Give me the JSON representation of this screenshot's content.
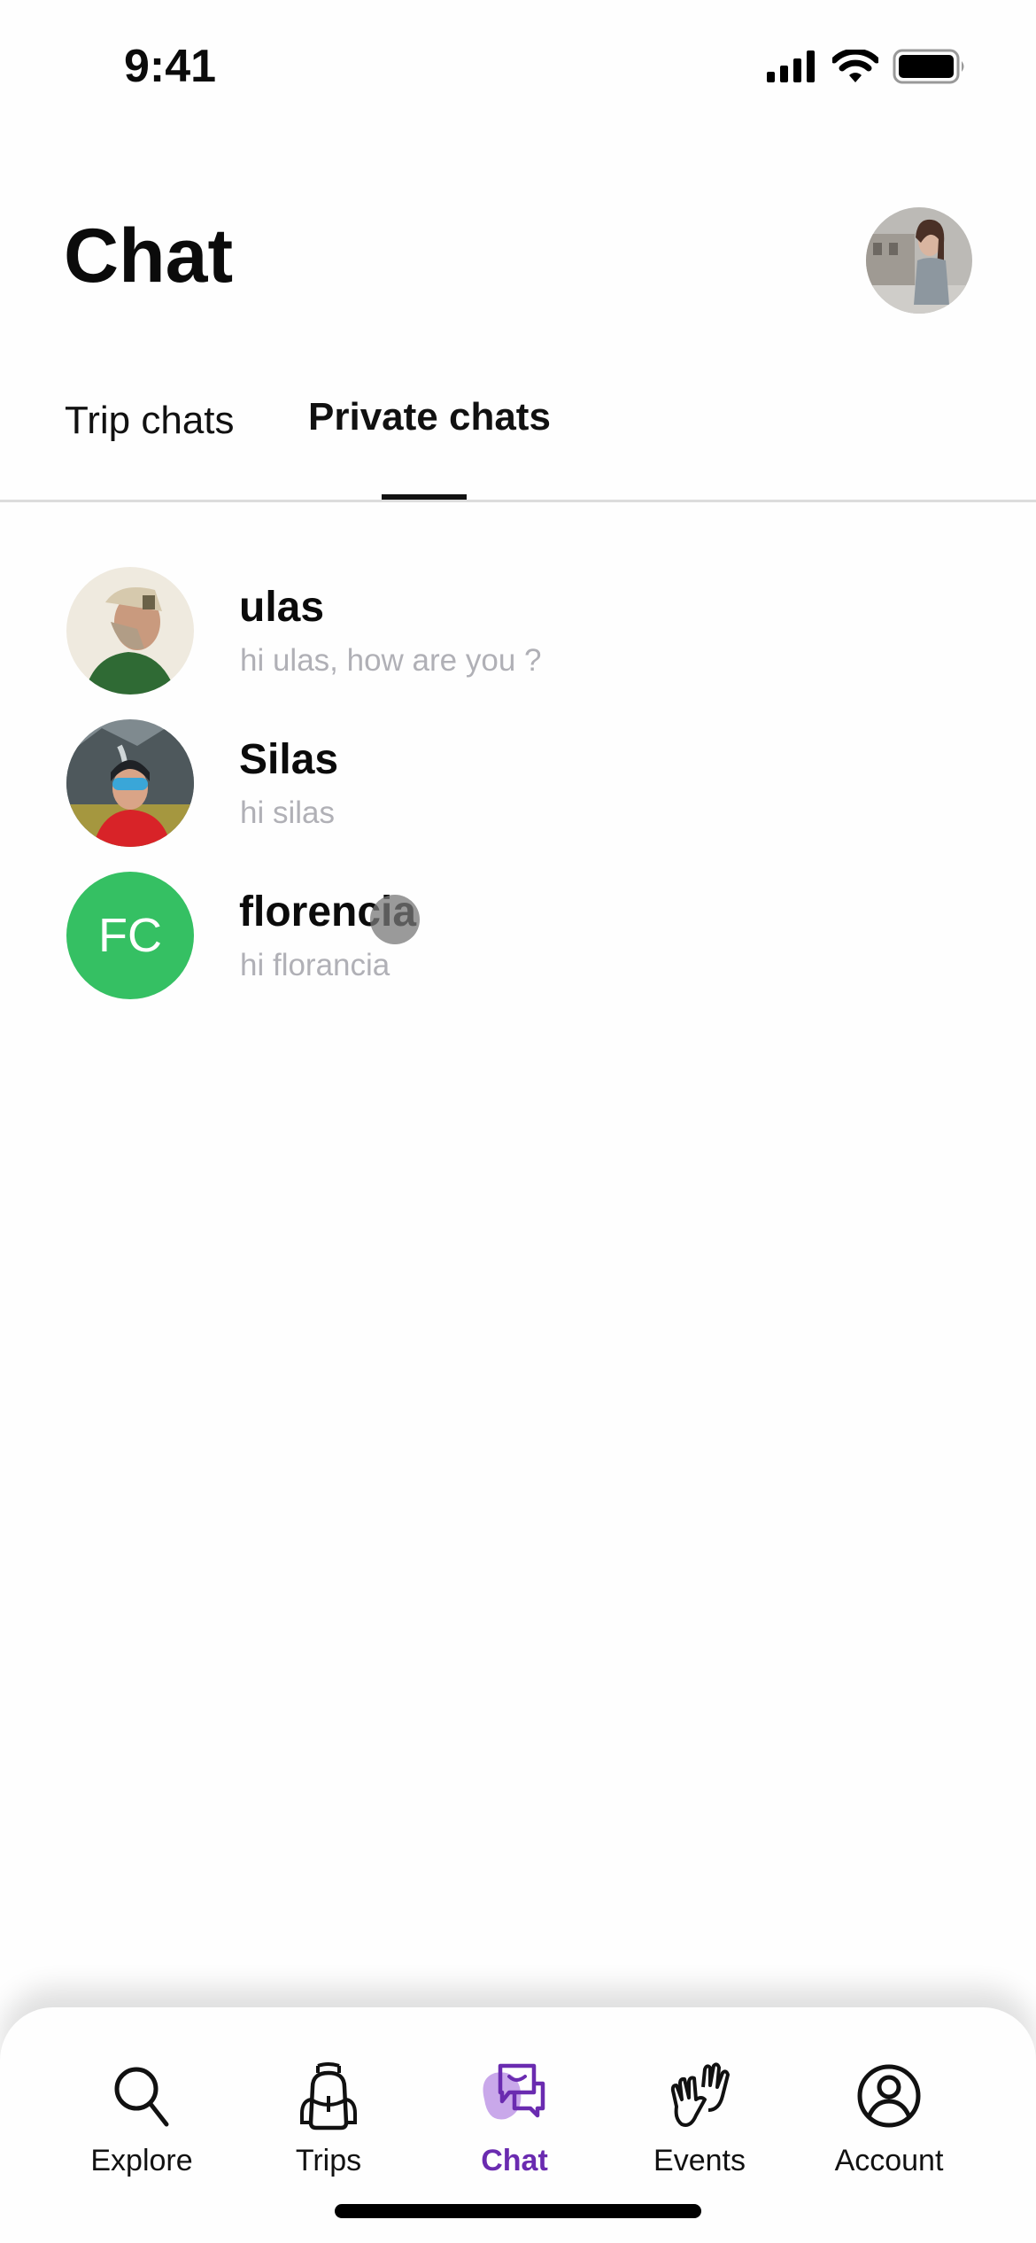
{
  "status_bar": {
    "time": "9:41"
  },
  "header": {
    "title": "Chat",
    "profile_avatar": "profile-photo"
  },
  "tabs": [
    {
      "label": "Trip chats",
      "active": false
    },
    {
      "label": "Private chats",
      "active": true
    }
  ],
  "chats": [
    {
      "name": "ulas",
      "last_message": "hi ulas, how are you ?",
      "avatar": "photo"
    },
    {
      "name": "Silas",
      "last_message": "hi silas",
      "avatar": "photo"
    },
    {
      "name": "florencia",
      "last_message": "hi florancia",
      "avatar": "initials",
      "initials": "FC",
      "avatar_color": "#35c063"
    }
  ],
  "nav": [
    {
      "label": "Explore",
      "icon": "search-icon",
      "active": false
    },
    {
      "label": "Trips",
      "icon": "backpack-icon",
      "active": false
    },
    {
      "label": "Chat",
      "icon": "chat-bubbles-icon",
      "active": true
    },
    {
      "label": "Events",
      "icon": "high-five-icon",
      "active": false
    },
    {
      "label": "Account",
      "icon": "account-icon",
      "active": false
    }
  ],
  "colors": {
    "accent": "#6a2bb0",
    "accent_light": "#c9a8ea",
    "green_avatar": "#35c063",
    "muted_text": "#b0b0b6"
  }
}
